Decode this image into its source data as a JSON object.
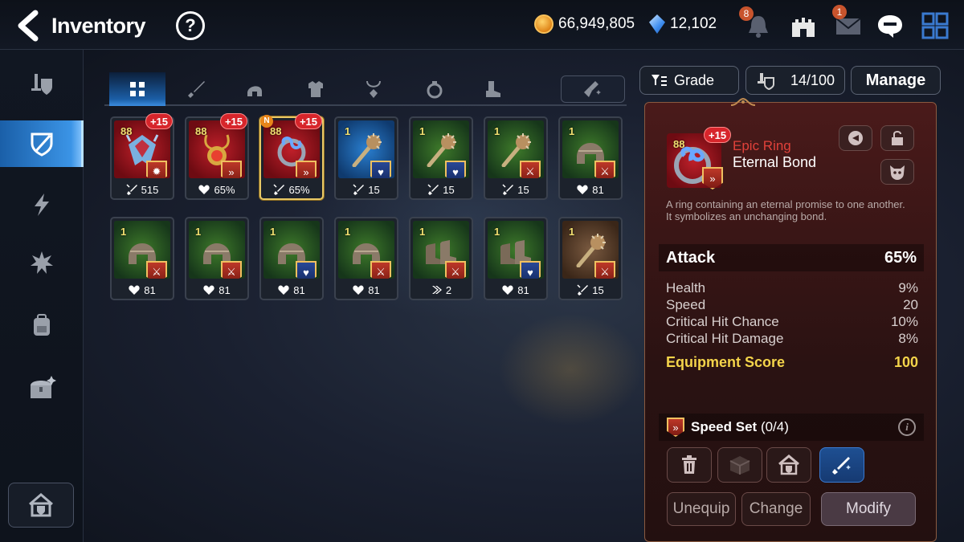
{
  "header": {
    "title": "Inventory",
    "help_label": "?",
    "gold": "66,949,805",
    "crystals": "12,102",
    "notifications_count": "8",
    "mail_count": "1"
  },
  "tabs": [
    {
      "name": "all",
      "icon": "grid-icon"
    },
    {
      "name": "weapon",
      "icon": "sword-icon"
    },
    {
      "name": "helmet",
      "icon": "helmet-icon"
    },
    {
      "name": "armor",
      "icon": "armor-icon"
    },
    {
      "name": "necklace",
      "icon": "necklace-icon"
    },
    {
      "name": "ring",
      "icon": "ring-icon"
    },
    {
      "name": "boots",
      "icon": "boots-icon"
    }
  ],
  "controls": {
    "grade_label": "Grade",
    "capacity": "14/100",
    "manage_label": "Manage"
  },
  "items": [
    {
      "level": "88",
      "enhance": "+15",
      "main_value": "515",
      "stat_icon": "attack"
    },
    {
      "level": "88",
      "enhance": "+15",
      "main_value": "65%",
      "stat_icon": "health"
    },
    {
      "level": "88",
      "enhance": "+15",
      "new": "N",
      "main_value": "65%",
      "stat_icon": "attack"
    },
    {
      "level": "1",
      "main_value": "15",
      "stat_icon": "attack"
    },
    {
      "level": "1",
      "main_value": "15",
      "stat_icon": "attack"
    },
    {
      "level": "1",
      "main_value": "15",
      "stat_icon": "attack"
    },
    {
      "level": "1",
      "main_value": "81",
      "stat_icon": "health"
    },
    {
      "level": "1",
      "main_value": "81",
      "stat_icon": "health"
    },
    {
      "level": "1",
      "main_value": "81",
      "stat_icon": "health"
    },
    {
      "level": "1",
      "main_value": "81",
      "stat_icon": "health"
    },
    {
      "level": "1",
      "main_value": "81",
      "stat_icon": "health"
    },
    {
      "level": "1",
      "main_value": "2",
      "stat_icon": "speed"
    },
    {
      "level": "1",
      "main_value": "81",
      "stat_icon": "health"
    },
    {
      "level": "1",
      "main_value": "15",
      "stat_icon": "attack"
    }
  ],
  "detail": {
    "level": "88",
    "enhance": "+15",
    "grade": "Epic Ring",
    "name": "Eternal Bond",
    "description_line1": "A ring containing an eternal promise to one another.",
    "description_line2": "It symbolizes an unchanging bond.",
    "main_stat": {
      "label": "Attack",
      "value": "65%"
    },
    "sub_stats": [
      {
        "label": "Health",
        "value": "9%"
      },
      {
        "label": "Speed",
        "value": "20"
      },
      {
        "label": "Critical Hit Chance",
        "value": "10%"
      },
      {
        "label": "Critical Hit Damage",
        "value": "8%"
      }
    ],
    "score": {
      "label": "Equipment Score",
      "value": "100"
    },
    "set": {
      "name": "Speed Set",
      "progress": "(0/4)",
      "info": "i"
    },
    "buttons": {
      "unequip": "Unequip",
      "change": "Change",
      "modify": "Modify"
    }
  },
  "colors": {
    "accent_blue": "#3b94e6",
    "epic_red": "#e0413a",
    "score_yellow": "#f4d44a",
    "enhance_red": "#d7252b",
    "selected_gold": "#e8c866"
  }
}
